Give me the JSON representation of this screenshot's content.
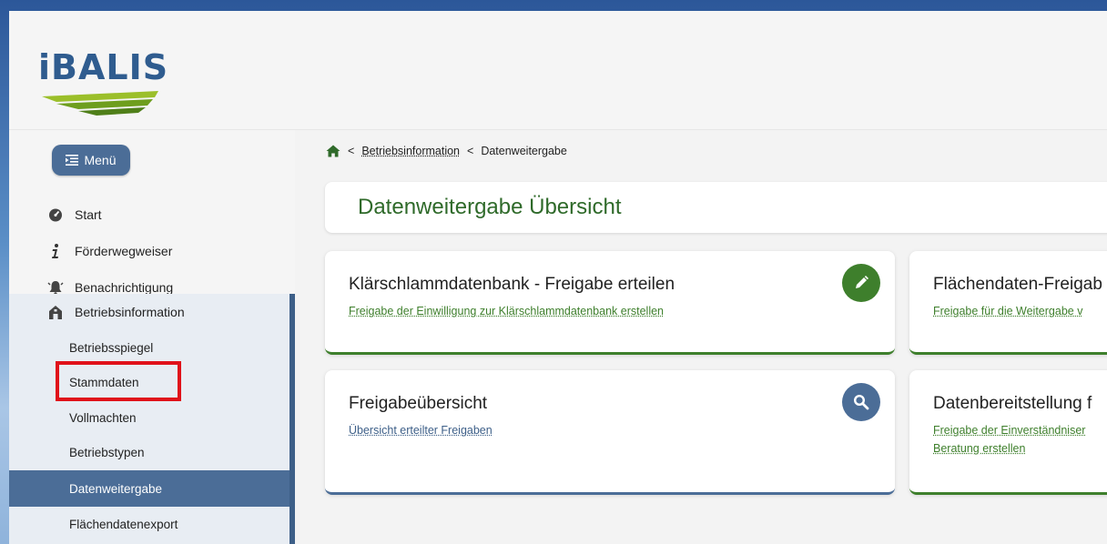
{
  "app": {
    "logo_text": "iBALIS"
  },
  "menu": {
    "label": "Menü"
  },
  "nav": {
    "items": [
      {
        "label": "Start",
        "icon": "dashboard-icon"
      },
      {
        "label": "Förderwegweiser",
        "icon": "info-icon"
      },
      {
        "label": "Benachrichtigung",
        "icon": "bell-icon"
      },
      {
        "label": "Betriebsinformation",
        "icon": "farm-icon"
      }
    ],
    "sub_items": [
      {
        "label": "Betriebsspiegel"
      },
      {
        "label": "Stammdaten"
      },
      {
        "label": "Vollmachten"
      },
      {
        "label": "Betriebstypen"
      },
      {
        "label": "Datenweitergabe"
      },
      {
        "label": "Flächendatenexport"
      }
    ]
  },
  "breadcrumb": {
    "separator": "<",
    "parent": "Betriebsinformation",
    "current": "Datenweitergabe"
  },
  "page": {
    "title": "Datenweitergabe Übersicht"
  },
  "cards": [
    {
      "title": "Klärschlammdatenbank - Freigabe erteilen",
      "link": "Freigabe der Einwilligung zur Klärschlammdatenbank erstellen",
      "icon": "pencil-icon"
    },
    {
      "title": "Flächendaten-Freigab",
      "link": "Freigabe für die Weitergabe v"
    },
    {
      "title": "Freigabeübersicht",
      "link": "Übersicht erteilter Freigaben",
      "icon": "search-icon"
    },
    {
      "title": "Datenbereitstellung f",
      "link_line1": "Freigabe der Einverständniser",
      "link_line2": "Beratung erstellen"
    }
  ],
  "colors": {
    "primary_blue": "#4b6d97",
    "primary_green": "#3e7f2c",
    "highlight_red": "#e0121a"
  }
}
